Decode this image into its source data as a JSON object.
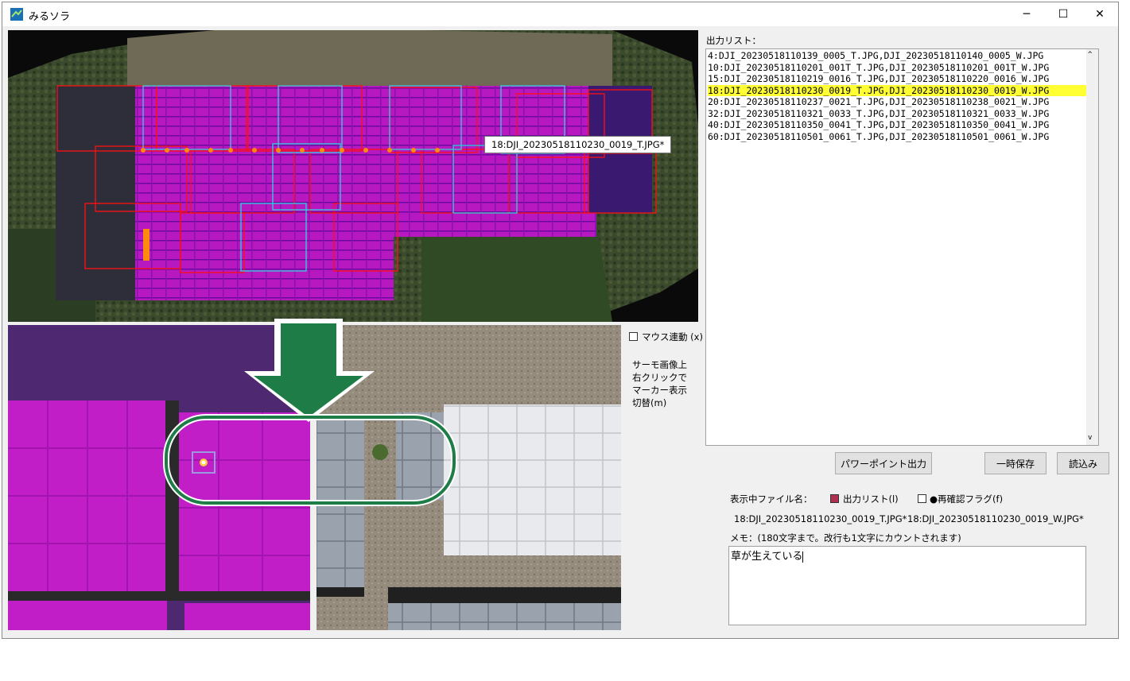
{
  "window": {
    "title": "みるソラ",
    "minimize": "─",
    "maximize": "☐",
    "close": "✕"
  },
  "output_list": {
    "label": "出力リスト：",
    "items": [
      "4:DJI_20230518110139_0005_T.JPG,DJI_20230518110140_0005_W.JPG",
      "10:DJI_20230518110201_001T_T.JPG,DJI_20230518110201_001T_W.JPG",
      "15:DJI_20230518110219_0016_T.JPG,DJI_20230518110220_0016_W.JPG",
      "18:DJI_20230518110230_0019_T.JPG,DJI_20230518110230_0019_W.JPG",
      "20:DJI_20230518110237_0021_T.JPG,DJI_20230518110238_0021_W.JPG",
      "32:DJI_20230518110321_0033_T.JPG,DJI_20230518110321_0033_W.JPG",
      "40:DJI_20230518110350_0041_T.JPG,DJI_20230518110350_0041_W.JPG",
      "60:DJI_20230518110501_0061_T.JPG,DJI_20230518110501_0061_W.JPG"
    ],
    "selected_index": 3
  },
  "tooltip": "18:DJI_20230518110230_0019_T.JPG*",
  "mouse_link": {
    "label": "マウス連動 (x)"
  },
  "help_text": {
    "line1": "サーモ画像上",
    "line2": "右クリックで",
    "line3": "マーカー表示",
    "line4": "切替(m)"
  },
  "buttons": {
    "powerpoint": "パワーポイント出力",
    "temp_save": "一時保存",
    "load": "読込み"
  },
  "display": {
    "label": "表示中ファイル名：",
    "output_list_flag": "出力リスト(l)",
    "recheck_flag": "●再確認フラグ(f)",
    "thermal_file": "18:DJI_20230518110230_0019_T.JPG*",
    "visual_file": "18:DJI_20230518110230_0019_W.JPG*"
  },
  "memo": {
    "label": "メモ：(180文字まで。改行も1文字にカウントされます)",
    "value": "草が生えている"
  },
  "colors": {
    "thermal": "#c020c8",
    "selection": "#ffff33",
    "arrow": "#1e7d46",
    "output_checkbox": "#b03050"
  }
}
